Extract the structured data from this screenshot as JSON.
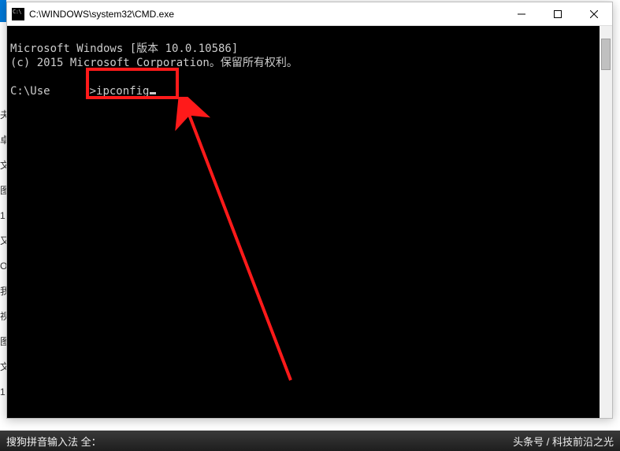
{
  "window": {
    "title": "C:\\WINDOWS\\system32\\CMD.exe"
  },
  "terminal": {
    "line1": "Microsoft Windows [版本 10.0.10586]",
    "line2": "(c) 2015 Microsoft Corporation。保留所有权利。",
    "prompt_prefix": "C:\\Use",
    "prompt_suffix": ">",
    "command": "ipconfig"
  },
  "ime": {
    "left": "搜狗拼音输入法 全：",
    "right": "头条号 / 科技前沿之光"
  },
  "fragments": [
    "夬",
    "卓",
    "文",
    "图",
    "1",
    "又",
    "O",
    "我",
    "视",
    "图",
    "文",
    "1"
  ]
}
